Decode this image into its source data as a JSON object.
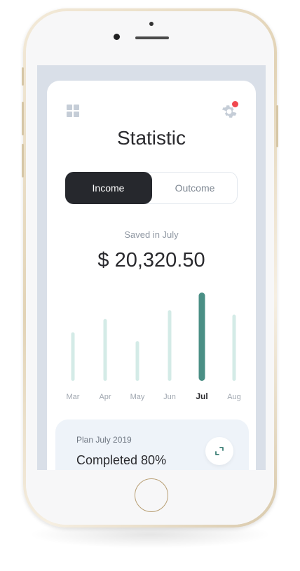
{
  "app": {
    "title": "Statistic",
    "icons": {
      "menu": "grid-icon",
      "settings": "gear-icon",
      "expand": "expand-icon"
    },
    "colors": {
      "accent": "#4a8f85",
      "bar_inactive": "#d4ebe7",
      "dark": "#26282d",
      "notification": "#f0484f"
    }
  },
  "toggle": {
    "income_label": "Income",
    "outcome_label": "Outcome",
    "selected": "Income"
  },
  "summary": {
    "caption": "Saved in July",
    "amount": "$ 20,320.50"
  },
  "chart_data": {
    "type": "bar",
    "categories": [
      "Mar",
      "Apr",
      "May",
      "Jun",
      "Jul",
      "Aug"
    ],
    "values": [
      55,
      70,
      45,
      80,
      100,
      75
    ],
    "highlighted": "Jul",
    "title": "",
    "xlabel": "",
    "ylabel": "",
    "ylim": [
      0,
      100
    ],
    "grid": false
  },
  "plan": {
    "label": "Plan July 2019",
    "status": "Completed 80%",
    "progress": 0.8
  }
}
